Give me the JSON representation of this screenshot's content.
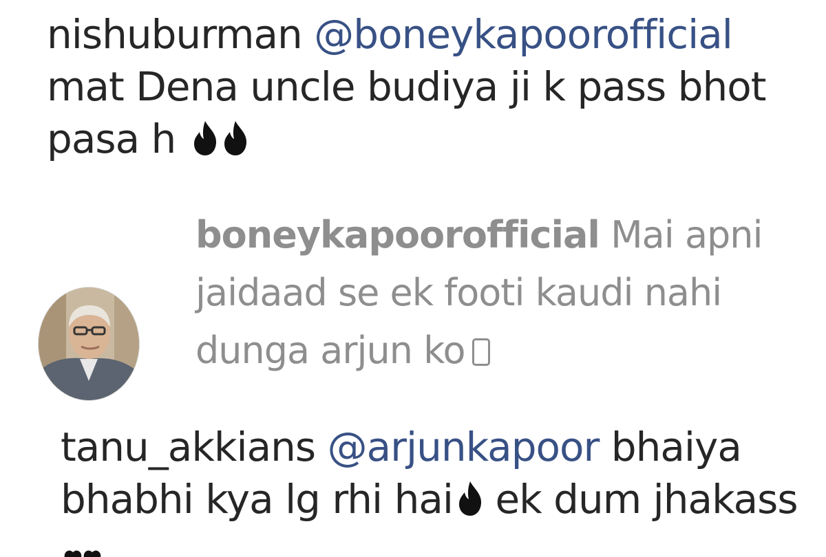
{
  "comments": [
    {
      "username": "nishuburman",
      "mention": "@boneykapoorofficial",
      "text_line1": "mat Dena uncle budiya ji k pass bhot",
      "text_line2": "pasa h"
    },
    {
      "username": "boneykapoorofficial",
      "text_line1": "Mai apni",
      "text_line2": "jaidaad se ek footi kaudi nahi",
      "text_line3": "dunga arjun ko"
    },
    {
      "username": "tanu_akkians",
      "mention": "@arjunkapoor",
      "text_line1_after": "bhaiya",
      "text_line2_before": "bhabhi kya lg rhi hai",
      "text_line2_after": "ek dum jhakass"
    }
  ],
  "icons": [
    "fire-emoji",
    "missing-glyph-box",
    "avatar-photo"
  ],
  "colors": {
    "text": "#262626",
    "reply_text": "#8e8e8e",
    "mention": "#385185"
  }
}
